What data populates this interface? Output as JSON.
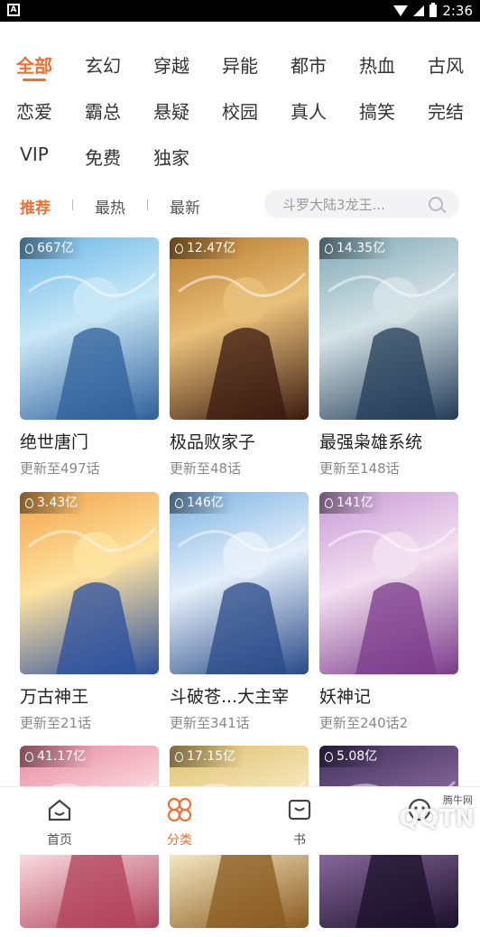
{
  "status_bar": {
    "time": "2:36"
  },
  "categories": [
    "全部",
    "玄幻",
    "穿越",
    "异能",
    "都市",
    "热血",
    "古风",
    "恋爱",
    "霸总",
    "悬疑",
    "校园",
    "真人",
    "搞笑",
    "完结",
    "VIP",
    "免费",
    "独家"
  ],
  "active_category": "全部",
  "sort": {
    "items": [
      "推荐",
      "最热",
      "最新"
    ],
    "active": "推荐"
  },
  "search": {
    "placeholder": "斗罗大陆3龙王..."
  },
  "comics": [
    {
      "views": "667亿",
      "title": "绝世唐门",
      "update": "更新至497话",
      "colors": [
        "#6bb8e8",
        "#c9e8f7",
        "#2f5f9a"
      ]
    },
    {
      "views": "12.47亿",
      "title": "极品败家子",
      "update": "更新至48话",
      "colors": [
        "#b77a2d",
        "#e9c07a",
        "#3a1a10"
      ]
    },
    {
      "views": "14.35亿",
      "title": "最强枭雄系统",
      "update": "更新至148话",
      "colors": [
        "#7fa8b7",
        "#d5e3e6",
        "#233b57"
      ]
    },
    {
      "views": "3.43亿",
      "title": "万古神王",
      "update": "更新至21话",
      "colors": [
        "#f0a34a",
        "#ffe3a0",
        "#2b4f9e"
      ]
    },
    {
      "views": "146亿",
      "title": "斗破苍...大主宰",
      "update": "更新至341话",
      "colors": [
        "#7ab2e0",
        "#e6f0fb",
        "#294a88"
      ]
    },
    {
      "views": "141亿",
      "title": "妖神记",
      "update": "更新至240话2",
      "colors": [
        "#c79ad6",
        "#f3e0f0",
        "#7a3a8a"
      ]
    },
    {
      "views": "41.17亿",
      "title": "",
      "update": "",
      "colors": [
        "#e98aa0",
        "#fde0e6",
        "#b0405a"
      ]
    },
    {
      "views": "17.15亿",
      "title": "",
      "update": "",
      "colors": [
        "#e0c070",
        "#f8ecc6",
        "#8a5a20"
      ]
    },
    {
      "views": "5.08亿",
      "title": "",
      "update": "",
      "colors": [
        "#40305a",
        "#8a6aa0",
        "#1a1028"
      ]
    }
  ],
  "tabs": [
    {
      "label": "首页",
      "icon": "home-icon"
    },
    {
      "label": "分类",
      "icon": "category-icon"
    },
    {
      "label": "书",
      "icon": "bookshelf-icon"
    },
    {
      "label": "",
      "icon": "profile-icon"
    }
  ],
  "active_tab": "分类",
  "watermark": {
    "text": "QQTN",
    "small": "腾牛网"
  },
  "accent_color": "#f07032"
}
